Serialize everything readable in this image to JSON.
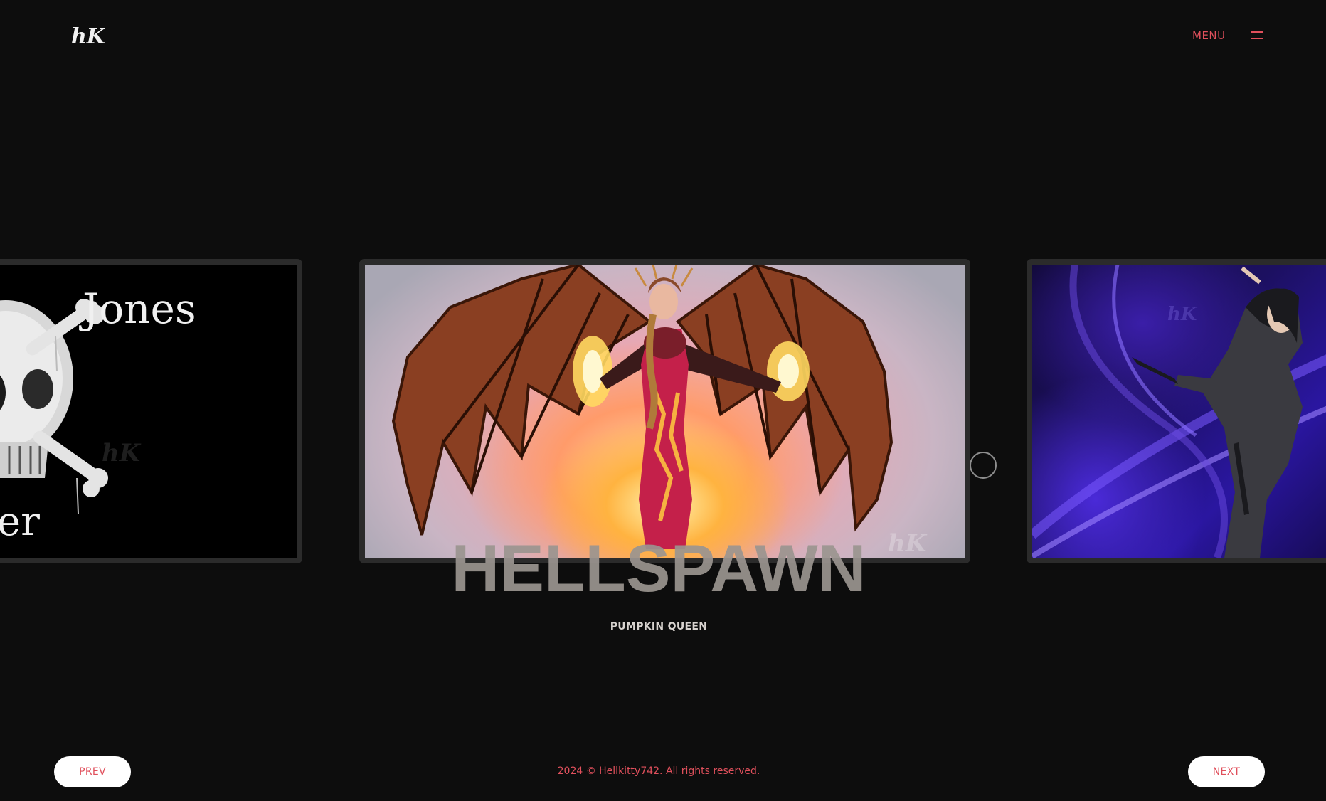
{
  "header": {
    "logo_text": "hK",
    "menu_label": "MENU"
  },
  "slides": {
    "left": {
      "artwork_text_top": "Jones",
      "artwork_text_bottom": "ker",
      "watermark": "hK"
    },
    "center": {
      "watermark": "hK"
    },
    "right": {
      "watermark": "hK"
    }
  },
  "current": {
    "title": "HELLSPAWN",
    "subtitle": "PUMPKIN QUEEN"
  },
  "footer": {
    "prev_label": "PREV",
    "next_label": "NEXT",
    "copyright": "2024 © Hellkitty742. All rights reserved."
  },
  "colors": {
    "background": "#0d0d0d",
    "accent": "#e0505c",
    "title": "#9b9590",
    "button_bg": "#ffffff"
  }
}
